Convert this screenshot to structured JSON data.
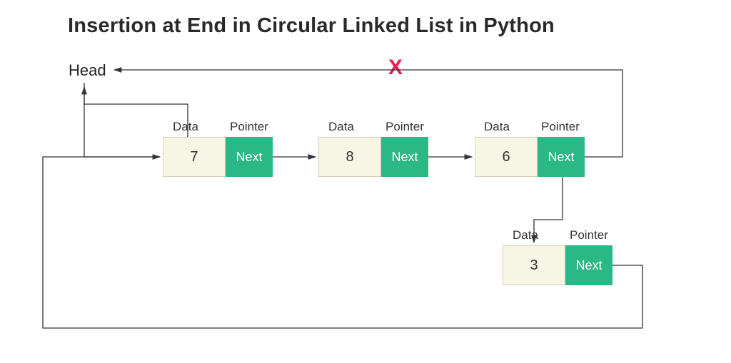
{
  "title": "Insertion at End in Circular Linked List in Python",
  "head_label": "Head",
  "labels": {
    "data": "Data",
    "pointer": "Pointer",
    "next": "Next"
  },
  "x_mark": "X",
  "nodes": {
    "n1": {
      "value": "7"
    },
    "n2": {
      "value": "8"
    },
    "n3": {
      "value": "6"
    },
    "n4": {
      "value": "3"
    }
  },
  "chart_data": {
    "type": "table",
    "description": "Circular singly linked list with insertion at end",
    "head": 0,
    "nodes": [
      {
        "index": 0,
        "data": 7,
        "next": 1
      },
      {
        "index": 1,
        "data": 8,
        "next": 2
      },
      {
        "index": 2,
        "data": 6,
        "next": 3,
        "old_next_before_insertion": 0
      },
      {
        "index": 3,
        "data": 3,
        "next": 0,
        "newly_inserted": true
      }
    ],
    "broken_link": {
      "from": 2,
      "to": 0
    }
  }
}
